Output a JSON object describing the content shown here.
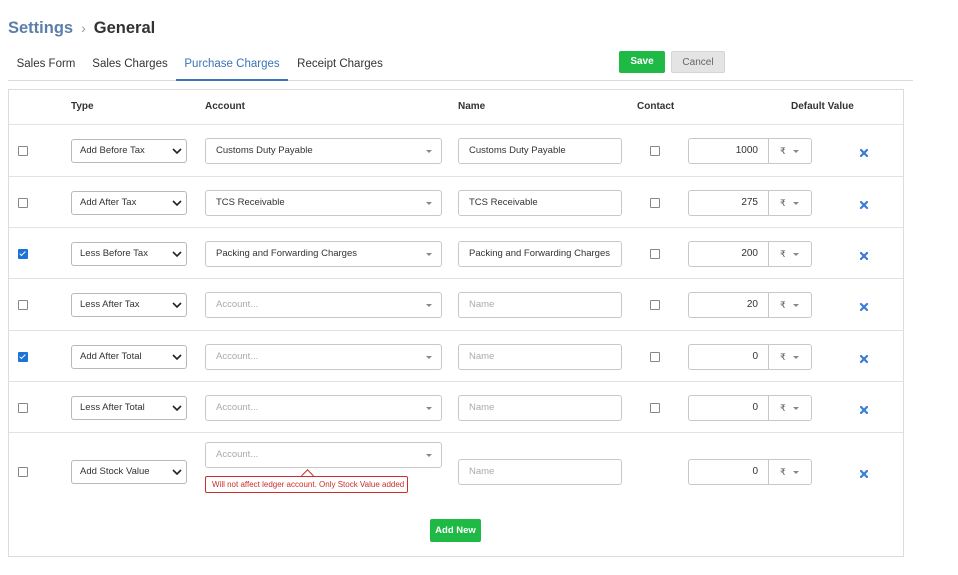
{
  "breadcrumb": {
    "root": "Settings",
    "separator": "›",
    "current": "General"
  },
  "tabs": [
    "Sales Form",
    "Sales Charges",
    "Purchase Charges",
    "Receipt Charges"
  ],
  "active_tab": "Purchase Charges",
  "toolbar": {
    "save_label": "Save",
    "cancel_label": "Cancel"
  },
  "table": {
    "headers": {
      "type": "Type",
      "account": "Account",
      "name": "Name",
      "contact": "Contact",
      "default_value": "Default Value"
    },
    "account_placeholder": "Account...",
    "name_placeholder": "Name",
    "rows": [
      {
        "checked": false,
        "type": "Add Before Tax",
        "account": "Customs Duty Payable",
        "name": "Customs Duty Payable",
        "contact": false,
        "value": "1000",
        "currency": "₹"
      },
      {
        "checked": false,
        "type": "Add After Tax",
        "account": "TCS Receivable",
        "name": "TCS Receivable",
        "contact": false,
        "value": "275",
        "currency": "₹"
      },
      {
        "checked": true,
        "type": "Less Before Tax",
        "account": "Packing and Forwarding Charges",
        "name": "Packing and Forwarding Charges",
        "contact": false,
        "value": "200",
        "currency": "₹"
      },
      {
        "checked": false,
        "type": "Less After Tax",
        "account": "",
        "name": "",
        "contact": false,
        "value": "20",
        "currency": "₹"
      },
      {
        "checked": true,
        "type": "Add After Total",
        "account": "",
        "name": "",
        "contact": false,
        "value": "0",
        "currency": "₹"
      },
      {
        "checked": false,
        "type": "Less After Total",
        "account": "",
        "name": "",
        "contact": false,
        "value": "0",
        "currency": "₹"
      },
      {
        "checked": false,
        "type": "Add Stock Value",
        "account": "",
        "name": "",
        "contact": null,
        "value": "0",
        "currency": "₹",
        "error": "Will not affect ledger account. Only Stock Value added"
      }
    ]
  },
  "add_new_label": "Add New",
  "colors": {
    "accent": "#3a74b6",
    "success": "#1fba45",
    "error": "#c9302c",
    "delete_icon": "#3a7bd5",
    "checkbox_checked": "#1d72d8"
  },
  "icons": {
    "breadcrumb_separator": "chevron-right-icon",
    "select": "chevron-down-icon",
    "delete": "close-icon"
  }
}
